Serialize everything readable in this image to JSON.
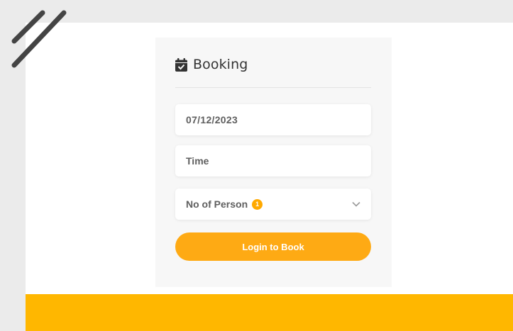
{
  "booking": {
    "title": "Booking",
    "title_icon": "calendar-check-icon",
    "date_value": "07/12/2023",
    "time_placeholder": "Time",
    "persons_label": "No of Person",
    "persons_badge": "1",
    "persons_dropdown_icon": "chevron-down-icon",
    "submit_label": "Login to Book"
  },
  "colors": {
    "accent": "#feaa14",
    "band": "#ffb700",
    "badge": "#ffa900",
    "card_bg": "#f7f7f7",
    "page_bg": "#ebebeb"
  },
  "decor": {
    "slashes_icon": "double-slash-decoration"
  }
}
